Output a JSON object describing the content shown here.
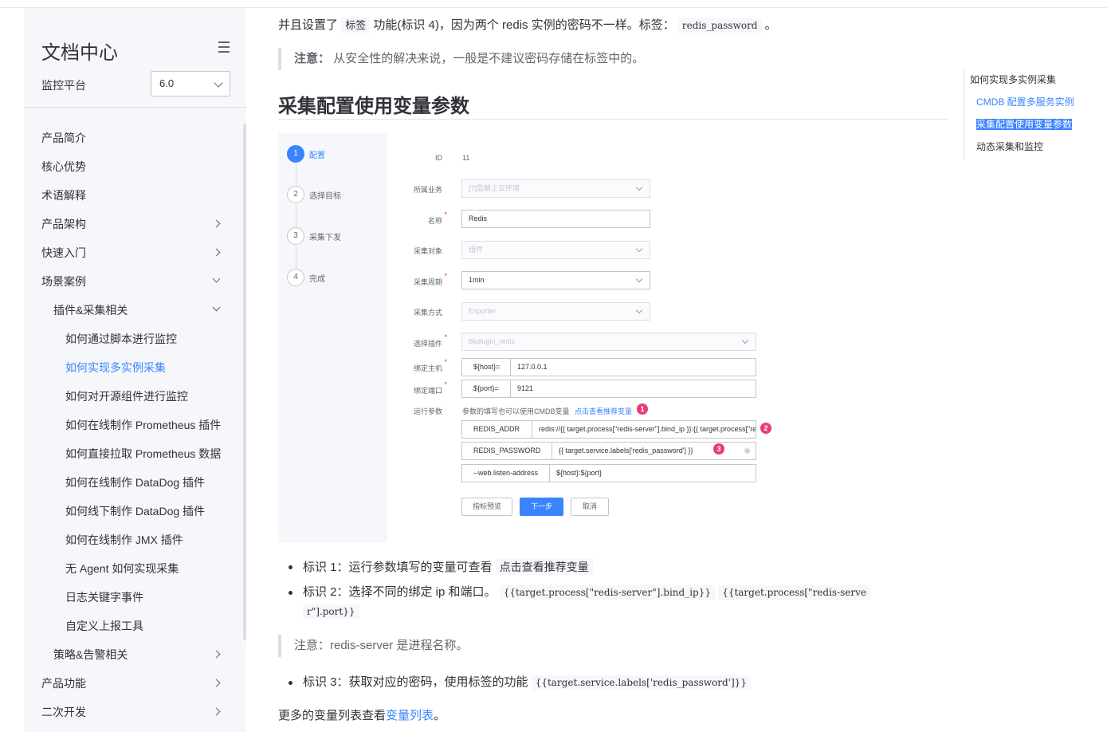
{
  "sidebar": {
    "title": "文档中心",
    "platform_label": "监控平台",
    "version": "6.0",
    "items": [
      {
        "label": "产品简介",
        "level": 1,
        "arrow": ""
      },
      {
        "label": "核心优势",
        "level": 1,
        "arrow": ""
      },
      {
        "label": "术语解释",
        "level": 1,
        "arrow": ""
      },
      {
        "label": "产品架构",
        "level": 1,
        "arrow": "right"
      },
      {
        "label": "快速入门",
        "level": 1,
        "arrow": "right"
      },
      {
        "label": "场景案例",
        "level": 1,
        "arrow": "down"
      },
      {
        "label": "插件&采集相关",
        "level": 2,
        "arrow": "down"
      },
      {
        "label": "如何通过脚本进行监控",
        "level": 3,
        "arrow": ""
      },
      {
        "label": "如何实现多实例采集",
        "level": 3,
        "arrow": "",
        "active": true
      },
      {
        "label": "如何对开源组件进行监控",
        "level": 3,
        "arrow": ""
      },
      {
        "label": "如何在线制作 Prometheus 插件",
        "level": 3,
        "arrow": ""
      },
      {
        "label": "如何直接拉取 Prometheus 数据",
        "level": 3,
        "arrow": ""
      },
      {
        "label": "如何在线制作 DataDog 插件",
        "level": 3,
        "arrow": ""
      },
      {
        "label": "如何线下制作 DataDog 插件",
        "level": 3,
        "arrow": ""
      },
      {
        "label": "如何在线制作 JMX 插件",
        "level": 3,
        "arrow": ""
      },
      {
        "label": "无 Agent 如何实现采集",
        "level": 3,
        "arrow": ""
      },
      {
        "label": "日志关键字事件",
        "level": 3,
        "arrow": ""
      },
      {
        "label": "自定义上报工具",
        "level": 3,
        "arrow": ""
      },
      {
        "label": "策略&告警相关",
        "level": 2,
        "arrow": "right"
      },
      {
        "label": "产品功能",
        "level": 1,
        "arrow": "right"
      },
      {
        "label": "二次开发",
        "level": 1,
        "arrow": "right"
      }
    ]
  },
  "content": {
    "intro_a": "并且设置了",
    "intro_tag": "标签",
    "intro_b": "功能(标识 4)，因为两个 redis 实例的密码不一样。标签：",
    "intro_code": "redis_password",
    "intro_end": "。",
    "note1_label": "注意：",
    "note1_text": "从安全性的解决来说，一般是不建议密码存储在标签中的。",
    "heading": "采集配置使用变量参数",
    "b1_text": "标识 1：运行参数填写的变量可查看",
    "b1_code": "点击查看推荐变量",
    "b2_text": "标识 2：选择不同的绑定 ip 和端口。",
    "b2_code1": "{{target.process[\"redis-server\"].bind_ip}}",
    "b2_code2a": "{{target.process[\"redis-serve",
    "b2_code2b": "r\"].port}}",
    "note2": "注意：redis-server 是进程名称。",
    "b3_text": "标识 3：获取对应的密码，使用标签的功能",
    "b3_code": "{{target.service.labels['redis_password']}}",
    "more_a": "更多的变量列表查看",
    "more_link": "变量列表",
    "more_end": "。"
  },
  "figure": {
    "steps": [
      {
        "num": "1",
        "label": "配置"
      },
      {
        "num": "2",
        "label": "选择目标"
      },
      {
        "num": "3",
        "label": "采集下发"
      },
      {
        "num": "4",
        "label": "完成"
      }
    ],
    "id_label": "ID",
    "id_value": "11",
    "biz_label": "所属业务",
    "biz_value": "[7]蓝鲸上云环境",
    "name_label": "名称",
    "name_value": "Redis",
    "object_label": "采集对象",
    "object_value": "组件",
    "period_label": "采集周期",
    "period_value": "1min",
    "method_label": "采集方式",
    "method_value": "Exporter",
    "plugin_label": "选择插件",
    "plugin_value": "bkplugin_redis",
    "host_label": "绑定主机",
    "host_key": "${host}=",
    "host_value": "127.0.0.1",
    "port_label": "绑定端口",
    "port_key": "${port}=",
    "port_value": "9121",
    "args_label": "运行参数",
    "args_hint": "参数的填写也可以使用CMDB变量",
    "args_link": "点击查看推荐变量",
    "redis_addr_key": "REDIS_ADDR",
    "redis_addr_value": "redis://{{ target.process[\"redis-server\"].bind_ip }}:{{ target.process[\"re",
    "redis_pwd_key": "REDIS_PASSWORD",
    "redis_pwd_value": "{{ target.service.labels['redis_password'] }}",
    "listen_key": "--web.listen-address",
    "listen_value": "${host}:${port}",
    "badge1": "1",
    "badge2": "2",
    "badge3": "3",
    "btn_preview": "指标预览",
    "btn_next": "下一步",
    "btn_cancel": "取消"
  },
  "toc": {
    "items": [
      "如何实现多实例采集",
      "CMDB 配置多服务实例",
      "采集配置使用变量参数",
      "动态采集和监控"
    ]
  },
  "colors": {
    "accent": "#3a84ff",
    "badge": "#ea3c6f",
    "sidebar_bg": "#f5f7fa"
  }
}
